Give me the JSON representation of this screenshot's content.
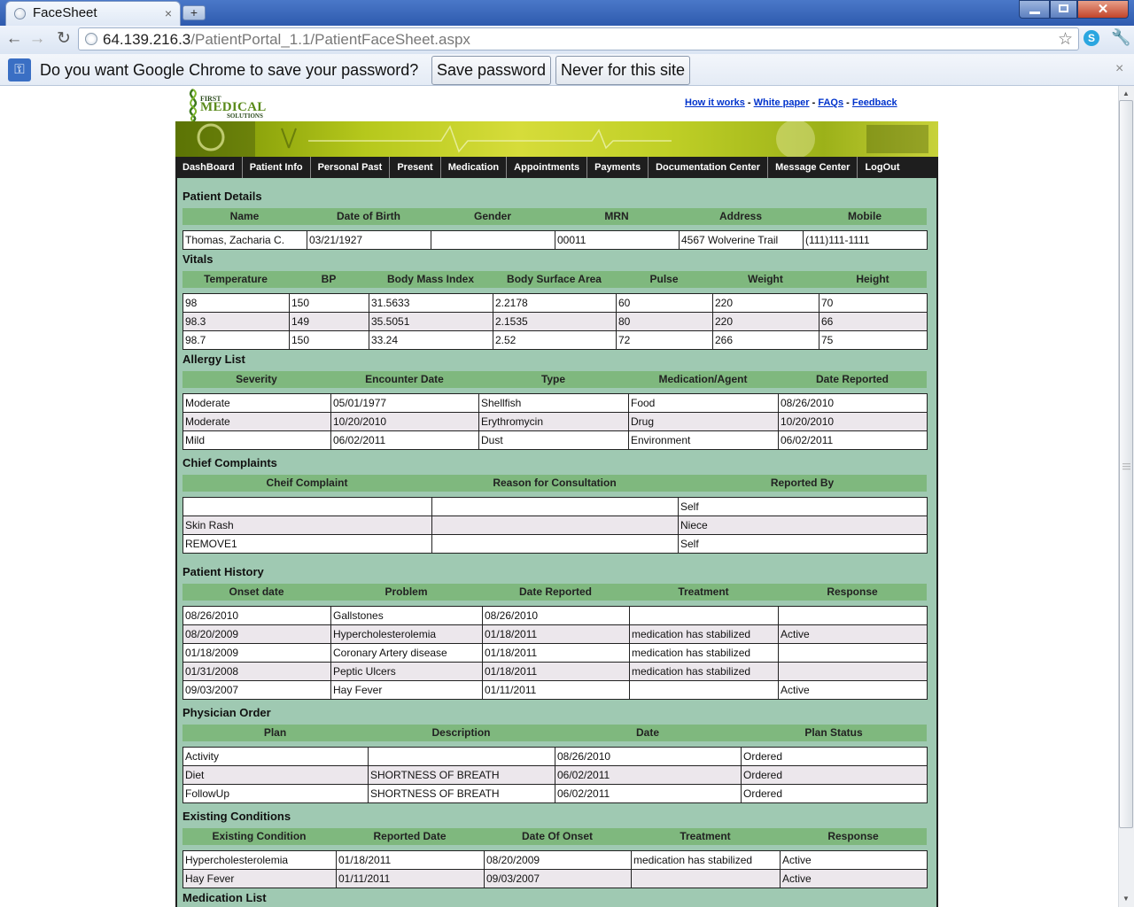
{
  "browser": {
    "tab_title": "FaceSheet",
    "tab_close": "×",
    "new_tab": "+",
    "url_host": "64.139.216.3",
    "url_path": "/PatientPortal_1.1/PatientFaceSheet.aspx",
    "infobar_message": "Do you want Google Chrome to save your password?",
    "save_password": "Save password",
    "never_for_site": "Never for this site",
    "infobar_close": "×",
    "icons": {
      "back": "back-arrow-icon",
      "forward": "forward-arrow-icon",
      "reload": "reload-icon",
      "star": "star-icon",
      "wrench": "wrench-icon",
      "key": "key-icon"
    }
  },
  "site": {
    "logo": {
      "line1": "FIRST",
      "line2": "MEDICAL",
      "line3": "SOLUTIONS"
    },
    "links": [
      "How it works",
      "White paper",
      "FAQs",
      "Feedback"
    ],
    "nav": [
      "DashBoard",
      "Patient Info",
      "Personal Past",
      "Present",
      "Medication",
      "Appointments",
      "Payments",
      "Documentation Center",
      "Message Center",
      "LogOut"
    ]
  },
  "sections": {
    "patient_details": {
      "title": "Patient Details",
      "headers": [
        "Name",
        "Date of Birth",
        "Gender",
        "MRN",
        "Address",
        "Mobile"
      ],
      "rows": [
        [
          "Thomas, Zacharia C.",
          "03/21/1927",
          "",
          "00011",
          "4567 Wolverine Trail",
          "(111)111-1111"
        ]
      ]
    },
    "vitals": {
      "title": "Vitals",
      "headers": [
        "Temperature",
        "BP",
        "Body Mass Index",
        "Body Surface Area",
        "Pulse",
        "Weight",
        "Height"
      ],
      "rows": [
        [
          "98",
          "150",
          "31.5633",
          "2.2178",
          "60",
          "220",
          "70"
        ],
        [
          "98.3",
          "149",
          "35.5051",
          "2.1535",
          "80",
          "220",
          "66"
        ],
        [
          "98.7",
          "150",
          "33.24",
          "2.52",
          "72",
          "266",
          "75"
        ]
      ]
    },
    "allergy": {
      "title": "Allergy List",
      "headers": [
        "Severity",
        "Encounter Date",
        "Type",
        "Medication/Agent",
        "Date Reported"
      ],
      "rows": [
        [
          "Moderate",
          "05/01/1977",
          "Shellfish",
          "Food",
          "08/26/2010"
        ],
        [
          "Moderate",
          "10/20/2010",
          "Erythromycin",
          "Drug",
          "10/20/2010"
        ],
        [
          "Mild",
          "06/02/2011",
          "Dust",
          "Environment",
          "06/02/2011"
        ]
      ]
    },
    "complaints": {
      "title": "Chief Complaints",
      "headers": [
        "Cheif Complaint",
        "Reason for Consultation",
        "Reported By"
      ],
      "rows": [
        [
          "",
          "",
          "Self"
        ],
        [
          "Skin Rash",
          "",
          "Niece"
        ],
        [
          "REMOVE1",
          "",
          "Self"
        ]
      ]
    },
    "history": {
      "title": "Patient History",
      "headers": [
        "Onset date",
        "Problem",
        "Date Reported",
        "Treatment",
        "Response"
      ],
      "rows": [
        [
          "08/26/2010",
          "Gallstones",
          "08/26/2010",
          "",
          ""
        ],
        [
          "08/20/2009",
          "Hypercholesterolemia",
          "01/18/2011",
          "medication has stabilized",
          "Active"
        ],
        [
          "01/18/2009",
          "Coronary Artery disease",
          "01/18/2011",
          "medication has stabilized",
          ""
        ],
        [
          "01/31/2008",
          "Peptic Ulcers",
          "01/18/2011",
          "medication has stabilized",
          ""
        ],
        [
          "09/03/2007",
          "Hay Fever",
          "01/11/2011",
          "",
          "Active"
        ]
      ]
    },
    "orders": {
      "title": "Physician Order",
      "headers": [
        "Plan",
        "Description",
        "Date",
        "Plan Status"
      ],
      "rows": [
        [
          "Activity",
          "",
          "08/26/2010",
          "Ordered"
        ],
        [
          "Diet",
          "SHORTNESS OF BREATH",
          "06/02/2011",
          "Ordered"
        ],
        [
          "FollowUp",
          "SHORTNESS OF BREATH",
          "06/02/2011",
          "Ordered"
        ]
      ]
    },
    "conditions": {
      "title": "Existing Conditions",
      "headers": [
        "Existing Condition",
        "Reported Date",
        "Date Of Onset",
        "Treatment",
        "Response"
      ],
      "rows": [
        [
          "Hypercholesterolemia",
          "01/18/2011",
          "08/20/2009",
          "medication has stabilized",
          "Active"
        ],
        [
          "Hay Fever",
          "01/11/2011",
          "09/03/2007",
          "",
          "Active"
        ]
      ]
    },
    "medication": {
      "title": "Medication List"
    }
  }
}
